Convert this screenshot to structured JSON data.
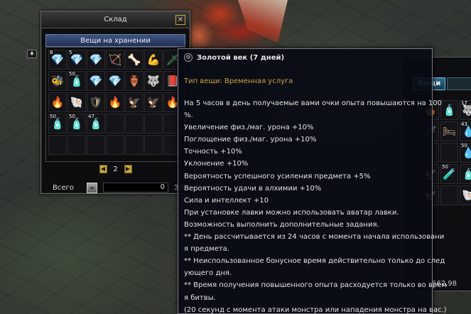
{
  "warehouse": {
    "title": "Склад",
    "close": "×",
    "tab": "Вещи на хранении",
    "page": "2",
    "prev": "◀",
    "next": "▶",
    "total_label": "Всего",
    "gold_icon": "≡",
    "money": "0",
    "currency": "ЗЛТ",
    "slots": [
      {
        "icon": "💎",
        "count": "8",
        "color": "#e0a0ff"
      },
      {
        "icon": "💎",
        "count": "5",
        "color": "#e0a0ff"
      },
      {
        "icon": "💎",
        "count": "",
        "color": "#e0a0ff"
      },
      {
        "icon": "🏹",
        "count": "",
        "color": "#d2b48c"
      },
      {
        "icon": "🦴",
        "count": "",
        "color": "#d8c8b0"
      },
      {
        "icon": "💪",
        "count": "",
        "color": "#d98a60"
      },
      {
        "icon": "🗡",
        "count": "",
        "color": "#4fb870"
      },
      {
        "icon": "🐝",
        "count": "",
        "color": "#e0c060"
      },
      {
        "icon": "🧴",
        "count": "50",
        "color": "#e05050"
      },
      {
        "icon": "💎",
        "count": "",
        "color": "#e0a0ff"
      },
      {
        "icon": "💎",
        "count": "",
        "color": "#e0a0ff"
      },
      {
        "icon": "🏺",
        "count": "",
        "color": "#e07070"
      },
      {
        "icon": "🐺",
        "count": "",
        "color": "#9fc0c0"
      },
      {
        "icon": "📕",
        "count": "",
        "color": "#d04030"
      },
      {
        "icon": "🔥",
        "count": "",
        "color": "#e06030"
      },
      {
        "icon": "🐚",
        "count": "",
        "color": "#e8d8c8"
      },
      {
        "icon": "🛡",
        "count": "",
        "color": "#b0a080"
      },
      {
        "icon": "🔥",
        "count": "",
        "color": "#e06030"
      },
      {
        "icon": "🦅",
        "count": "",
        "color": "#d8b060"
      },
      {
        "icon": "🦅",
        "count": "",
        "color": "#c8a050"
      },
      {
        "icon": "🔥",
        "count": "",
        "color": "#e08030"
      },
      {
        "icon": "🧴",
        "count": "50",
        "color": "#e05050"
      },
      {
        "icon": "🧴",
        "count": "50",
        "color": "#e05050"
      },
      {
        "icon": "🧴",
        "count": "47",
        "color": "#e05050"
      },
      {
        "icon": "",
        "count": "",
        "color": "#000"
      },
      {
        "icon": "",
        "count": "",
        "color": "#000"
      },
      {
        "icon": "",
        "count": "",
        "color": "#000"
      },
      {
        "icon": "",
        "count": "",
        "color": "#000"
      },
      {
        "icon": "",
        "count": "",
        "color": "#000"
      },
      {
        "icon": "",
        "count": "",
        "color": "#000"
      },
      {
        "icon": "",
        "count": "",
        "color": "#000"
      },
      {
        "icon": "",
        "count": "",
        "color": "#000"
      },
      {
        "icon": "",
        "count": "",
        "color": "#000"
      },
      {
        "icon": "",
        "count": "",
        "color": "#000"
      },
      {
        "icon": "",
        "count": "",
        "color": "#000"
      }
    ]
  },
  "inventory": {
    "tab": "Вещи",
    "money": "562,98",
    "slots": [
      {
        "icon": "🔥",
        "count": "",
        "color": "#e06030"
      },
      {
        "icon": "🧴",
        "count": "",
        "color": "#e05050"
      },
      {
        "icon": "🐺",
        "count": "17",
        "color": "#9fc0c0"
      },
      {
        "icon": "🗡",
        "count": "",
        "color": "#9fa0a0"
      },
      {
        "icon": "🛏",
        "count": "",
        "color": "#c8a070"
      },
      {
        "icon": "💧",
        "count": "43",
        "color": "#6080ff"
      },
      {
        "icon": "",
        "count": "",
        "color": "#000"
      },
      {
        "icon": "",
        "count": "",
        "color": "#000"
      },
      {
        "icon": "💧",
        "count": "50",
        "color": "#6080ff"
      },
      {
        "icon": "🦅",
        "count": "",
        "color": "#c8a050"
      },
      {
        "icon": "🧪",
        "count": "50",
        "color": "#6080ff"
      },
      {
        "icon": "🧴",
        "count": "",
        "color": "#e05050"
      },
      {
        "icon": "🦅",
        "count": "",
        "color": "#c8a050"
      },
      {
        "icon": "",
        "count": "",
        "color": "#000"
      },
      {
        "icon": "🐚",
        "count": "",
        "color": "#c0c0c0"
      }
    ]
  },
  "side_icon": "♦",
  "tooltip": {
    "icon": "⚙",
    "title": "Золотой век (7 дней)",
    "type": "Тип вещи: Временная услуга",
    "lines": [
      "На 5 часов в день получаемые вами очки опыта повышаются на 100",
      "%.",
      "Увеличение физ./маг. урона +10%",
      "Поглощение физ./маг. урона +10%",
      "Точность +10%",
      "Уклонение +10%",
      "Вероятность успешного усиления предмета +5%",
      "Вероятность удачи в алхимии +10%",
      "Сила и интеллект +10",
      "При установке лавки можно использовать аватар лавки.",
      "Возможность выполнить дополнительные задания.",
      "** День рассчитывается из 24 часов с момента начала использовани",
      "я предмета.",
      "** Неиспользованное бонусное время действительно только до след",
      "ующего дня.",
      "** Время получения повышенного опыта расходуется только во врем",
      "я битвы.",
      "(20 секунд с момента атаки монстра или нападения монстра на вас.)"
    ]
  }
}
